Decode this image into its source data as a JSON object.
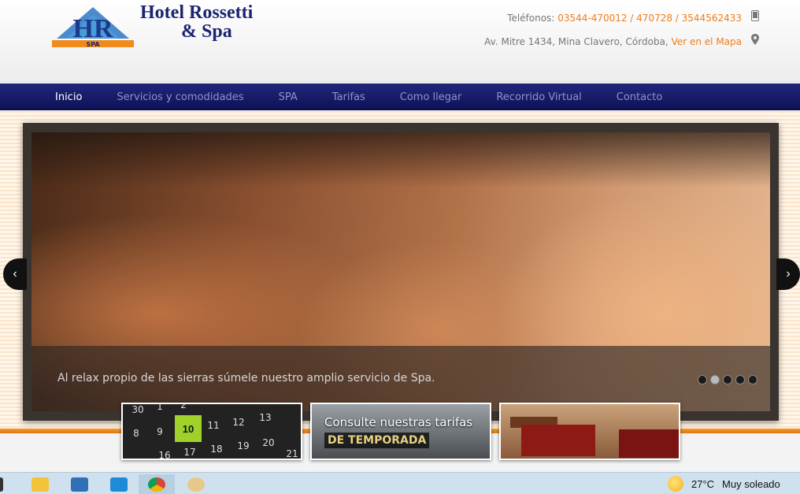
{
  "header": {
    "brand_line1": "Hotel Rossetti",
    "brand_line2": "& Spa",
    "logo_letters": "HR",
    "logo_sub": "SPA",
    "phone_label": "Teléfonos:",
    "phone_numbers": "03544-470012 / 470728 / 3544562433",
    "address": "Av. Mitre 1434, Mina Clavero, Córdoba,",
    "map_link": "Ver en el Mapa"
  },
  "nav": {
    "items": [
      "Inicio",
      "Servicios y comodidades",
      "SPA",
      "Tarifas",
      "Como llegar",
      "Recorrido Virtual",
      "Contacto"
    ],
    "active_index": 0
  },
  "slider": {
    "caption": "Al relax propio de las sierras súmele nuestro amplio servicio de Spa.",
    "slide_count": 5,
    "active_slide": 2
  },
  "thumbnails": {
    "calendar_numbers": [
      "1",
      "2",
      "8",
      "9",
      "10",
      "11",
      "12",
      "13",
      "16",
      "17",
      "18",
      "19",
      "20",
      "21",
      "30"
    ],
    "tarifas_line1": "Consulte nuestras tarifas",
    "tarifas_line2": "DE TEMPORADA"
  },
  "taskbar": {
    "temperature": "27°C",
    "weather": "Muy soleado"
  },
  "colors": {
    "brand_blue": "#1a2470",
    "accent_orange": "#ef7d1a",
    "nav_bg": "#161a6a"
  }
}
